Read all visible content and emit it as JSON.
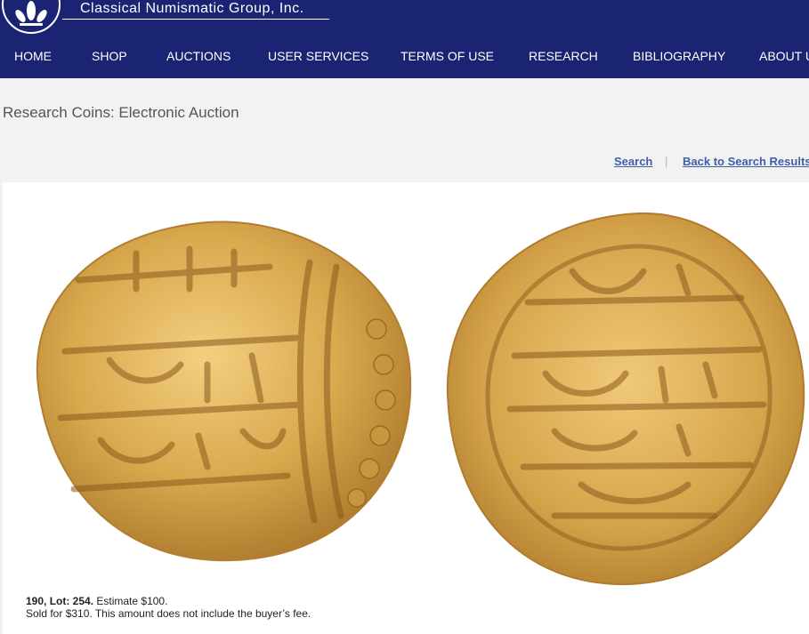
{
  "brand": {
    "name": "Classical Numismatic Group, Inc."
  },
  "nav": {
    "items": [
      {
        "label": "HOME"
      },
      {
        "label": "SHOP"
      },
      {
        "label": "AUCTIONS"
      },
      {
        "label": "USER SERVICES"
      },
      {
        "label": "TERMS OF USE"
      },
      {
        "label": "RESEARCH"
      },
      {
        "label": "BIBLIOGRAPHY"
      },
      {
        "label": "ABOUT U"
      }
    ]
  },
  "page": {
    "title": "Research Coins: Electronic Auction"
  },
  "actions": {
    "search": "Search",
    "separator": "|",
    "back": "Back to Search Results"
  },
  "lot": {
    "sale_lot": "190, Lot: 254.",
    "estimate": "Estimate $100.",
    "sold_note": "Sold for $310. This amount does not include the buyer’s fee."
  },
  "colors": {
    "header_bg": "#1a2472",
    "link": "#3f5fa6",
    "coin_gold": "#d9a94e"
  }
}
